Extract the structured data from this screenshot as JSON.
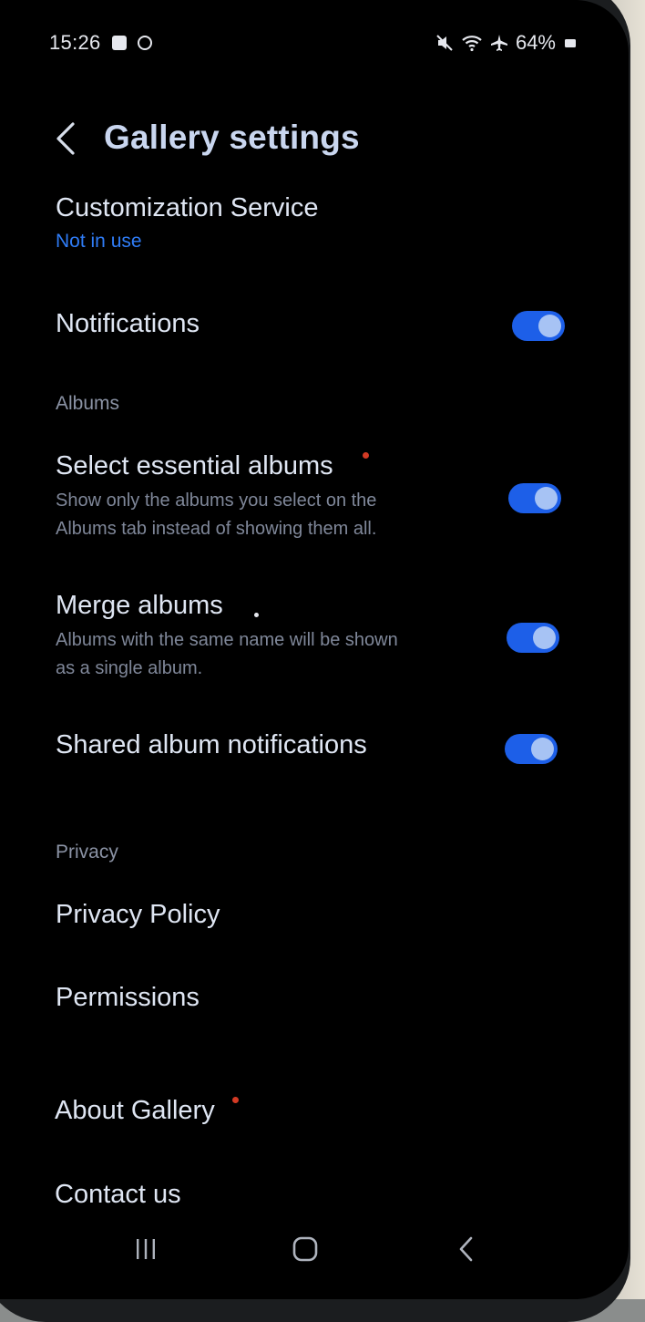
{
  "status_bar": {
    "time": "15:26",
    "battery": "64%",
    "icons_left": [
      "checkbox-icon",
      "circle-icon"
    ],
    "icons_right": [
      "mute-icon",
      "wifi-icon",
      "airplane-icon",
      "battery-icon"
    ]
  },
  "header": {
    "title": "Gallery settings",
    "back_icon": "chevron-left-icon"
  },
  "customization": {
    "title": "Customization Service",
    "value": "Not in use"
  },
  "notifications": {
    "title": "Notifications",
    "enabled": true
  },
  "albums_section": {
    "header": "Albums",
    "select_essential": {
      "title": "Select essential albums",
      "sub_line1": "Show only the albums you select on the",
      "sub_line2": "Albums tab instead of showing them all.",
      "enabled": true
    },
    "merge": {
      "title": "Merge albums",
      "sub_line1": "Albums with the same name will be shown",
      "sub_line2": "as a single album.",
      "enabled": true
    },
    "shared_notifications": {
      "title": "Shared album notifications",
      "enabled": true
    }
  },
  "privacy_section": {
    "header": "Privacy",
    "policy": "Privacy Policy",
    "permissions": "Permissions"
  },
  "about": "About Gallery",
  "contact": "Contact us",
  "nav": [
    "recents-icon",
    "home-icon",
    "back-icon"
  ],
  "colors": {
    "accent": "#1d5fe8",
    "link": "#2f7cf6",
    "badge": "#d33a24"
  }
}
